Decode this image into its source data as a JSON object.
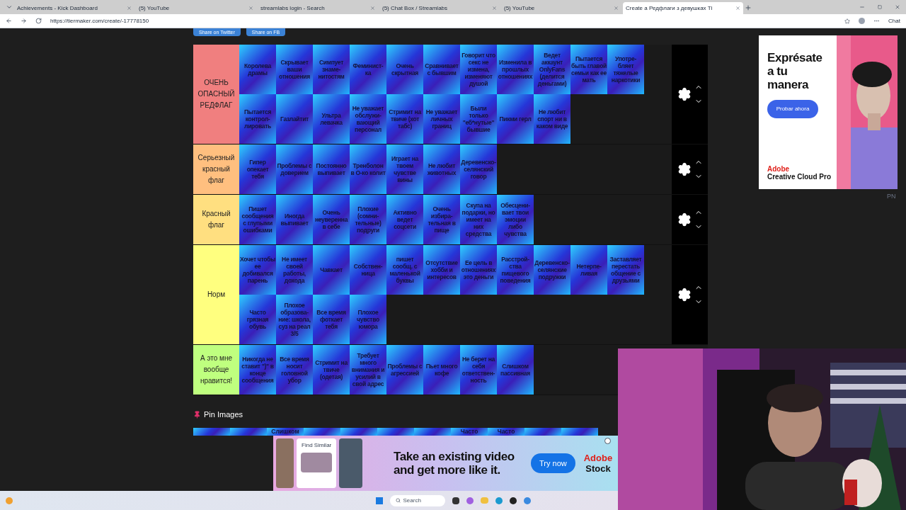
{
  "browser": {
    "tabs": [
      {
        "title": "Achievements - Kick Dashboard",
        "selected": false
      },
      {
        "title": "(5) YouTube",
        "selected": false
      },
      {
        "title": "streamlabs login - Search",
        "selected": false
      },
      {
        "title": "(5) Chat Box / Streamlabs",
        "selected": false
      },
      {
        "title": "(5) YouTube",
        "selected": false
      },
      {
        "title": "Create a Редфлаги з девушках Ti",
        "selected": true
      }
    ],
    "url": "https://tiermaker.com/create/-17778150",
    "chat_label": "Chat"
  },
  "share_buttons": [
    "Share on Twitter",
    "Share on FB"
  ],
  "tiers": [
    {
      "label": "ОЧЕНЬ ОПАСНЫЙ РЕДФЛАГ",
      "color": "#f07f7f",
      "items": [
        "Королева драмы",
        "Скрывает ваши отношения",
        "Симпует знаме-нитостям",
        "Феминист-ка",
        "Очень скрытная",
        "Сравнивает с бывшим",
        "Говорит что секс не измена, изменяют душой",
        "Изменила в прошлых отношениях",
        "Ведет аккаунт OnlyFans (делится деньгами)",
        "Пытается быть главой семьи как ее мать",
        "Употре-бляет тяжелые наркотики",
        "Пытается контрол-лировать",
        "Газлайтит",
        "Ультра левачка",
        "Не уважает обслужи-вающий персонал",
        "Стримит на твиче (хот табс)",
        "Не уважает личных границ",
        "Были только \"еб*нутые\" бывшие",
        "Пикми герл",
        "Не любит спорт ни в каком виде"
      ]
    },
    {
      "label": "Серьезный красный флаг",
      "color": "#ffbf7f",
      "items": [
        "Гипер опекает тебя",
        "Проблемы с доверием",
        "Постоянно выпивает",
        "Тренболон в О-ко колит",
        "Играет на твоем чувстве вины",
        "Не любит животных",
        "Деревенско-селянский говор"
      ]
    },
    {
      "label": "Красный флаг",
      "color": "#ffdf80",
      "items": [
        "Пишет сообщения с глупыми ошибками",
        "Иногда выпивает",
        "Очень неуверенна в себе",
        "Плохие (сомни-тельные) подруги",
        "Активно ведет соцсети",
        "Очень избира-тельная в пище",
        "Скупа на подарки, но имеет на них средства",
        "Обесцени-вает твои эмоции либо чувства"
      ]
    },
    {
      "label": "Норм",
      "color": "#ffff7f",
      "items": [
        "Хочет чтобы ее добивался парень",
        "Не имеет своей работы, дохода",
        "Чавкает",
        "Собствен-ница",
        "пишет сообщ. с маленькой буквы",
        "Отсутствие хобби и интересов",
        "Ее цель в отношениях это деньги",
        "Расстрой-ства пищевого поведения",
        "Деревенско-селянские подружки",
        "Нетерпе-ливая",
        "Заставляет перестать общение с друзьями",
        "Часто грязная обувь",
        "Плохое образова-ние: школа, суз на реал 3/5",
        "Все время фоткает тебя",
        "Плохое чувство юмора"
      ]
    },
    {
      "label": "А это мне вообще нравится!",
      "color": "#bfff7f",
      "items": [
        "Никогда не ставит \")\" в конце сообщения",
        "Все время носит головной убор",
        "Стримит на твиче (одетая)",
        "Требует много внимания и усилий в свой адрес",
        "Проблемы с агрессией",
        "Пьет много кофе",
        "Не берет на себя ответствен-ность",
        "Слишком пассивная"
      ],
      "controls_visible": false
    }
  ],
  "pin_images": {
    "title": "Pin Images",
    "items": [
      {
        "kind": "blank"
      },
      {
        "kind": "blank"
      },
      {
        "kind": "text",
        "label": "Слишком"
      },
      {
        "kind": "blank"
      },
      {
        "kind": "blank"
      },
      {
        "kind": "blank"
      },
      {
        "kind": "blank"
      },
      {
        "kind": "text",
        "label": "Часто"
      },
      {
        "kind": "text",
        "label": "Часто"
      },
      {
        "kind": "blank"
      },
      {
        "kind": "blank"
      }
    ]
  },
  "side_ad": {
    "headline": "Exprésate a tu manera",
    "button": "Probar ahora",
    "brand": "Adobe",
    "product": "Creative Cloud Pro",
    "tag": "PN"
  },
  "bottom_ad": {
    "card_label": "Find Similar",
    "headline": "Take an existing video and get more like it.",
    "button": "Try now",
    "brand": "Adobe",
    "product": "Stock"
  },
  "taskbar": {
    "search_placeholder": "Search"
  }
}
